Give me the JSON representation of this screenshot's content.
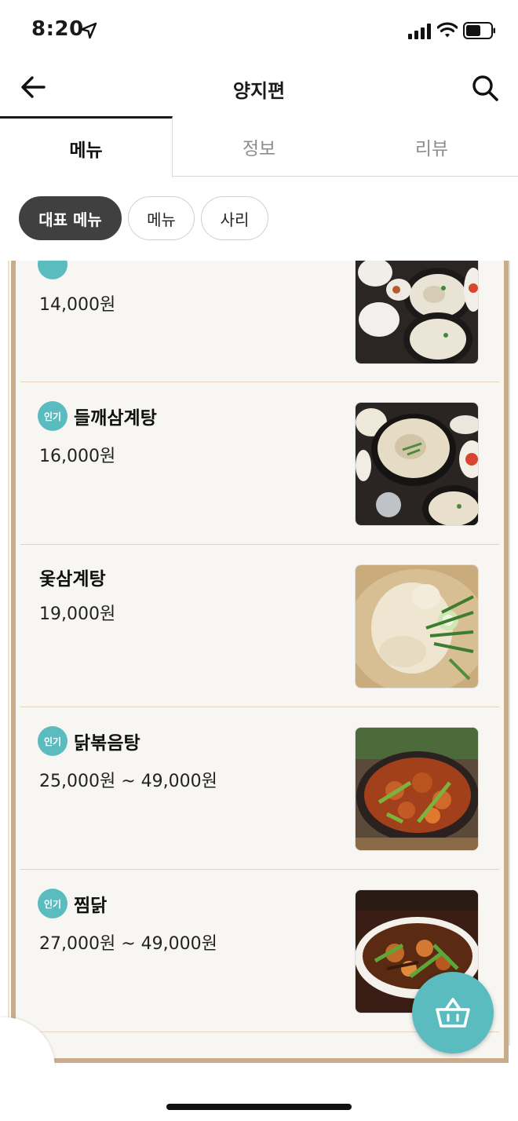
{
  "status_bar": {
    "time": "8:20"
  },
  "header": {
    "title": "양지편"
  },
  "tabs": [
    {
      "label": "메뉴",
      "active": true
    },
    {
      "label": "정보",
      "active": false
    },
    {
      "label": "리뷰",
      "active": false
    }
  ],
  "chips": [
    {
      "label": "대표 메뉴",
      "selected": true
    },
    {
      "label": "메뉴",
      "selected": false
    },
    {
      "label": "사리",
      "selected": false
    }
  ],
  "menu_items": [
    {
      "name": "",
      "price": "14,000원",
      "popular": true,
      "photo": "samgyetang-set-photo"
    },
    {
      "name": "들깨삼계탕",
      "price": "16,000원",
      "popular": true,
      "popular_label": "인기",
      "photo": "perilla-samgyetang-photo"
    },
    {
      "name": "옻삼계탕",
      "price": "19,000원",
      "popular": false,
      "photo": "lacquer-samgyetang-photo"
    },
    {
      "name": "닭볶음탕",
      "price": "25,000원 ~ 49,000원",
      "popular": true,
      "popular_label": "인기",
      "photo": "braised-chicken-stew-photo"
    },
    {
      "name": "찜닭",
      "price": "27,000원 ~ 49,000원",
      "popular": true,
      "popular_label": "인기",
      "photo": "jjimdak-photo"
    }
  ],
  "colors": {
    "accent": "#5bbcbf",
    "board_frame": "#c9ad8b",
    "chip_selected": "#404040"
  },
  "icons": [
    "location-arrow-icon",
    "signal-icon",
    "wifi-icon",
    "battery-icon",
    "back-arrow-icon",
    "search-icon",
    "basket-icon"
  ]
}
